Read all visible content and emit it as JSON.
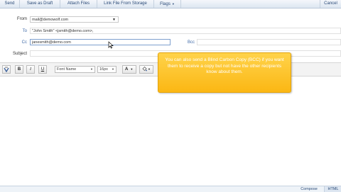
{
  "toolbar": {
    "send": "Send",
    "save_draft": "Save as Draft",
    "attach_files": "Attach Files",
    "link_file": "Link File From Storage",
    "flags": "Flags",
    "cancel": "Cancel"
  },
  "form": {
    "from_label": "From",
    "from_value": "mail@demowolf.com",
    "to_label": "To",
    "to_value": "\"John Smith\" <jsmith@demo.com>,",
    "cc_label": "Cc",
    "cc_value": "janesmith@demo.com",
    "bcc_label": "Bcc",
    "bcc_value": "",
    "subject_label": "Subject",
    "subject_value": ""
  },
  "editor": {
    "bold": "B",
    "italic": "I",
    "underline": "U",
    "font_name": "Font Name",
    "font_size": "16px",
    "text_color_icon": "A"
  },
  "tooltip": {
    "text": "You can also send a Blind Carbon Copy (BCC) if you want them to receive a copy but not have the other recipients know about them."
  },
  "bottom": {
    "compose": "Compose",
    "html": "HTML"
  },
  "colors": {
    "accent_blue": "#3f6aa8",
    "tooltip_orange": "#fbb714"
  }
}
